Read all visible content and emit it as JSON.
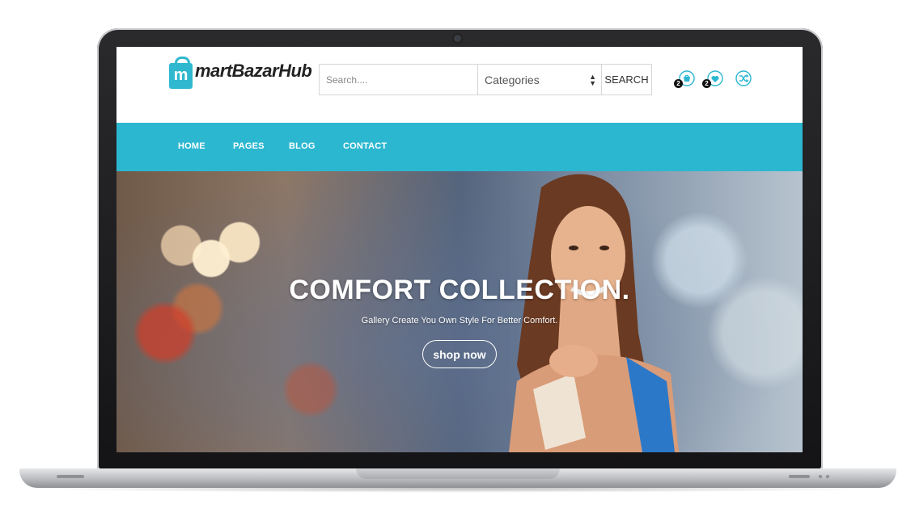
{
  "brand": {
    "logo_letter": "m",
    "name": "martBazarHub",
    "accent": "#2cb7d0"
  },
  "search": {
    "placeholder": "Search....",
    "category_selected": "Categories",
    "button_label": "SEARCH"
  },
  "header_icons": [
    {
      "name": "cart-icon",
      "count": "2"
    },
    {
      "name": "wishlist-heart-icon",
      "count": "2"
    },
    {
      "name": "compare-shuffle-icon"
    }
  ],
  "nav": {
    "items": [
      "HOME",
      "PAGES",
      "BLOG",
      "CONTACT"
    ]
  },
  "hero": {
    "title": "COMFORT COLLECTION.",
    "subtitle": "Gallery Create You Own Style For Better Comfort.",
    "cta_label": "shop now"
  }
}
